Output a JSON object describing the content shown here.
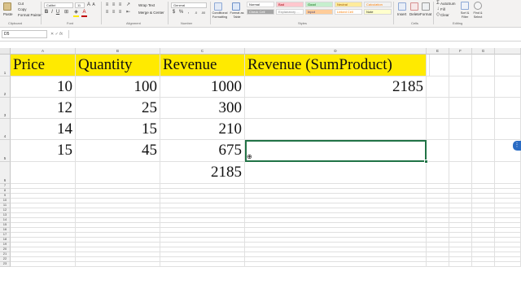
{
  "ribbon": {
    "clipboard": {
      "paste_label": "Paste",
      "cut_label": "Cut",
      "copy_label": "Copy",
      "format_painter_label": "Format Painter",
      "group_label": "Clipboard"
    },
    "font": {
      "font_name": "Calibri",
      "font_size": "11",
      "group_label": "Font"
    },
    "alignment": {
      "wrap_text_label": "Wrap Text",
      "merge_center_label": "Merge & Center",
      "group_label": "Alignment"
    },
    "number": {
      "format_value": "General",
      "group_label": "Number"
    },
    "styles": {
      "conditional_formatting_label": "Conditional Formatting",
      "format_as_table_label": "Format as Table",
      "cells": [
        {
          "label": "Normal",
          "bg": "#ffffff",
          "color": "#222222"
        },
        {
          "label": "Bad",
          "bg": "#ffc7ce",
          "color": "#9c0006"
        },
        {
          "label": "Good",
          "bg": "#c6efce",
          "color": "#006100"
        },
        {
          "label": "Neutral",
          "bg": "#ffeb9c",
          "color": "#9c5700"
        },
        {
          "label": "Calculation",
          "bg": "#f2f2f2",
          "color": "#fa7d00"
        },
        {
          "label": "Check Cell",
          "bg": "#a5a5a5",
          "color": "#ffffff"
        },
        {
          "label": "Explanatory ...",
          "bg": "#ffffff",
          "color": "#7f7f7f"
        },
        {
          "label": "Input",
          "bg": "#ffcc99",
          "color": "#3f3f76"
        },
        {
          "label": "Linked Cell",
          "bg": "#ffffff",
          "color": "#fa7d00"
        },
        {
          "label": "Note",
          "bg": "#ffffcc",
          "color": "#222222"
        }
      ],
      "group_label": "Styles"
    },
    "cells_group": {
      "insert_label": "Insert",
      "delete_label": "Delete",
      "format_label": "Format",
      "group_label": "Cells"
    },
    "editing": {
      "autosum_label": "AutoSum",
      "fill_label": "Fill",
      "clear_label": "Clear",
      "sort_filter_label": "Sort & Filter",
      "find_select_label": "Find & Select",
      "group_label": "Editing"
    }
  },
  "formula_bar": {
    "name_box": "D5",
    "formula": ""
  },
  "columns": [
    {
      "letter": "A"
    },
    {
      "letter": "B"
    },
    {
      "letter": "C"
    },
    {
      "letter": "D"
    },
    {
      "letter": "E"
    },
    {
      "letter": "F"
    },
    {
      "letter": "G"
    }
  ],
  "rows": [
    "1",
    "2",
    "3",
    "4",
    "5",
    "6",
    "7",
    "8",
    "9",
    "10",
    "11",
    "12",
    "13",
    "14",
    "15",
    "16",
    "17",
    "18",
    "19",
    "20",
    "21",
    "22",
    "23"
  ],
  "sheet": {
    "headers": {
      "a1": "Price",
      "b1": "Quantity",
      "c1": "Revenue",
      "d1": "Revenue (SumProduct)"
    },
    "data": [
      {
        "price": "10",
        "quantity": "100",
        "revenue": "1000",
        "sumproduct": "2185"
      },
      {
        "price": "12",
        "quantity": "25",
        "revenue": "300",
        "sumproduct": ""
      },
      {
        "price": "14",
        "quantity": "15",
        "revenue": "210",
        "sumproduct": ""
      },
      {
        "price": "15",
        "quantity": "45",
        "revenue": "675",
        "sumproduct": ""
      }
    ],
    "c6_total": "2185",
    "header_fill": "#ffea00",
    "selection_color": "#217346"
  }
}
